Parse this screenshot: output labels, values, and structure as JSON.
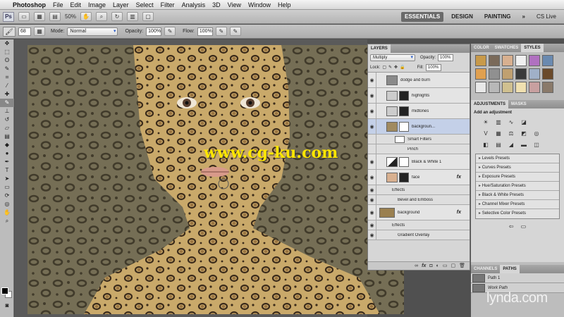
{
  "menubar": {
    "app_name": "Photoshop",
    "items": [
      "File",
      "Edit",
      "Image",
      "Layer",
      "Select",
      "Filter",
      "Analysis",
      "3D",
      "View",
      "Window",
      "Help"
    ]
  },
  "appbar": {
    "badge": "Ps",
    "zoom": "50%",
    "workspaces": [
      "ESSENTIALS",
      "DESIGN",
      "PAINTING"
    ],
    "more": "»",
    "cs_live": "CS Live"
  },
  "options": {
    "brush_size": "68",
    "mode_label": "Mode:",
    "mode_value": "Normal",
    "opacity_label": "Opacity:",
    "opacity_value": "100%",
    "flow_label": "Flow:",
    "flow_value": "100%"
  },
  "watermark": "www.cg-ku.com",
  "layers_panel": {
    "tabs": [
      "LAYERS"
    ],
    "blend_mode": "Multiply",
    "opacity_label": "Opacity:",
    "opacity_value": "100%",
    "lock_label": "Lock:",
    "fill_label": "Fill:",
    "fill_value": "100%",
    "rows": [
      {
        "name": "dodge and burn",
        "kind": "layer"
      },
      {
        "name": "highlights",
        "kind": "layer"
      },
      {
        "name": "midtones",
        "kind": "layer"
      },
      {
        "name": "backgroun...",
        "kind": "layer",
        "selected": true
      },
      {
        "name": "Smart Filters",
        "kind": "sub"
      },
      {
        "name": "Pinch",
        "kind": "sub"
      },
      {
        "name": "Black & White 1",
        "kind": "layer"
      },
      {
        "name": "face",
        "kind": "layer",
        "fx": "fx"
      },
      {
        "name": "Effects",
        "kind": "sub"
      },
      {
        "name": "Bevel and Emboss",
        "kind": "sub"
      },
      {
        "name": "background",
        "kind": "layer",
        "fx": "fx"
      },
      {
        "name": "Effects",
        "kind": "sub"
      },
      {
        "name": "Gradient Overlay",
        "kind": "sub"
      }
    ],
    "footer": [
      "fx"
    ]
  },
  "right_panels": {
    "top_tabs": [
      "COLOR",
      "SWATCHES",
      "STYLES"
    ],
    "style_colors": [
      "#c89a4a",
      "#7a6a5a",
      "#d8b090",
      "#f0f0f0",
      "#b070c0",
      "#6a8ab0",
      "#e0a050",
      "#909090",
      "#c0a070",
      "#3a3a3a",
      "#a0b0c8",
      "#6a4a2a",
      "#e8e8e8",
      "#b8b8b8",
      "#d0c090",
      "#f0e0b0",
      "#c8a0a0",
      "#8a7a6a"
    ],
    "adj_tabs": [
      "ADJUSTMENTS",
      "MASKS"
    ],
    "adj_title": "Add an adjustment",
    "presets": [
      "Levels Presets",
      "Curves Presets",
      "Exposure Presets",
      "Hue/Saturation Presets",
      "Black & White Presets",
      "Channel Mixer Presets",
      "Selective Color Presets"
    ],
    "bottom_tabs": [
      "CHANNELS",
      "PATHS"
    ],
    "paths": [
      "Path 1",
      "Work Path"
    ]
  },
  "brand": "lynda.com",
  "colors": {
    "selection": "#c4d0e8",
    "watermark": "#ffe600",
    "fur": "#c9a96a",
    "spot": "#3a2a1a"
  }
}
